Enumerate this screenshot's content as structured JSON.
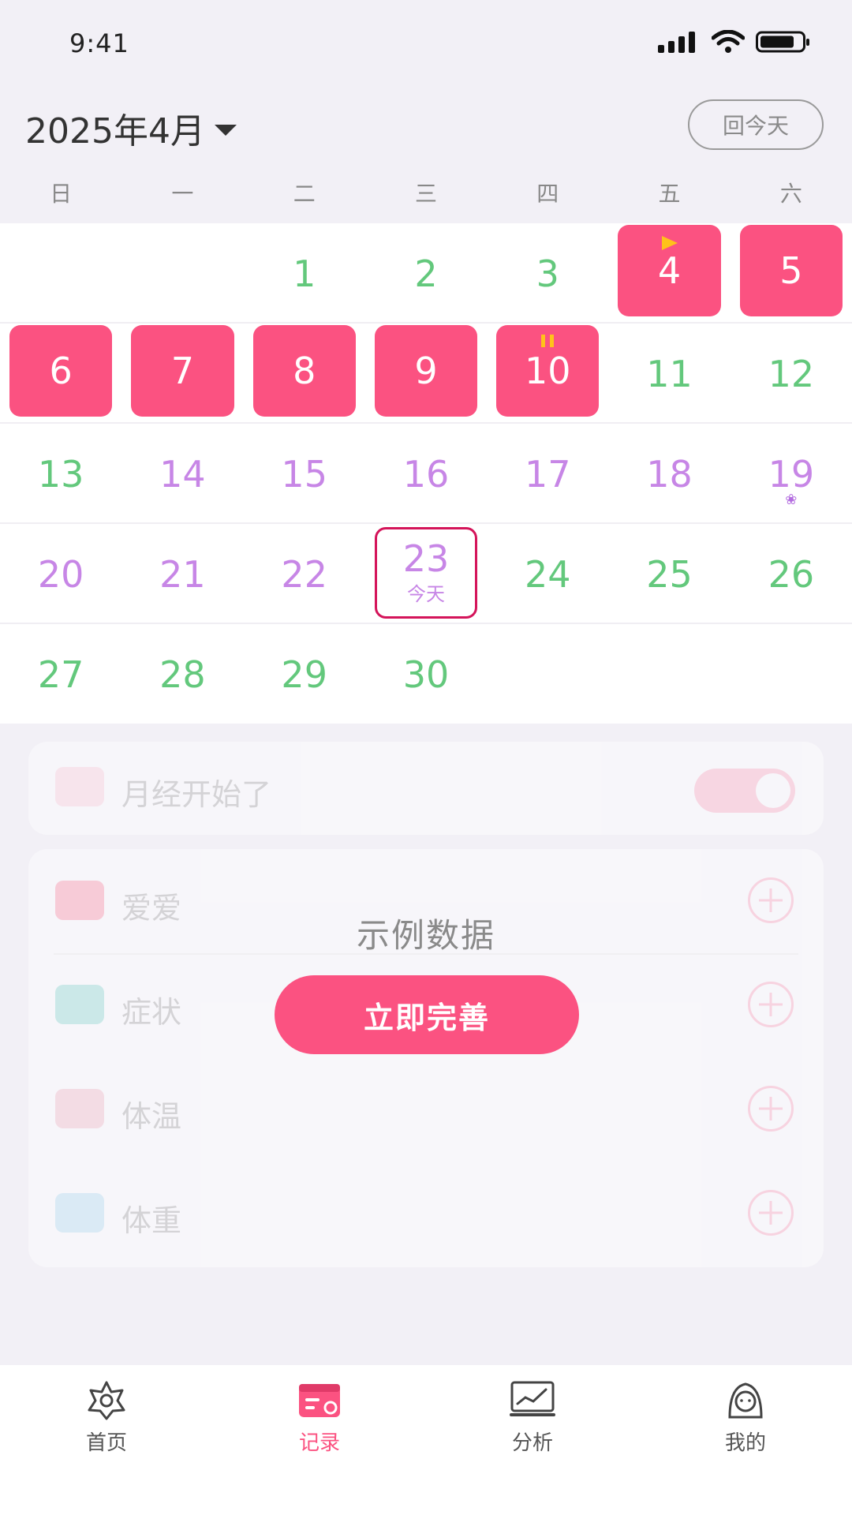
{
  "status": {
    "time": "9:41"
  },
  "header": {
    "month_title": "2025年4月",
    "today_button": "回今天"
  },
  "weekdays": [
    "日",
    "一",
    "二",
    "三",
    "四",
    "五",
    "六"
  ],
  "calendar": {
    "today_label": "今天",
    "days": [
      {
        "n": "1",
        "c": "green"
      },
      {
        "n": "2",
        "c": "green"
      },
      {
        "n": "3",
        "c": "green"
      },
      {
        "n": "4",
        "c": "period",
        "mark": "triangle"
      },
      {
        "n": "5",
        "c": "period"
      },
      {
        "n": "6",
        "c": "period"
      },
      {
        "n": "7",
        "c": "period"
      },
      {
        "n": "8",
        "c": "period"
      },
      {
        "n": "9",
        "c": "period"
      },
      {
        "n": "10",
        "c": "period",
        "mark": "pause"
      },
      {
        "n": "11",
        "c": "green"
      },
      {
        "n": "12",
        "c": "green"
      },
      {
        "n": "13",
        "c": "green"
      },
      {
        "n": "14",
        "c": "purple"
      },
      {
        "n": "15",
        "c": "purple"
      },
      {
        "n": "16",
        "c": "purple"
      },
      {
        "n": "17",
        "c": "purple"
      },
      {
        "n": "18",
        "c": "purple"
      },
      {
        "n": "19",
        "c": "purple",
        "mark": "flower"
      },
      {
        "n": "20",
        "c": "purple"
      },
      {
        "n": "21",
        "c": "purple"
      },
      {
        "n": "22",
        "c": "purple"
      },
      {
        "n": "23",
        "c": "purple",
        "today": true
      },
      {
        "n": "24",
        "c": "green"
      },
      {
        "n": "25",
        "c": "green"
      },
      {
        "n": "26",
        "c": "green"
      },
      {
        "n": "27",
        "c": "green"
      },
      {
        "n": "28",
        "c": "green"
      },
      {
        "n": "29",
        "c": "green"
      },
      {
        "n": "30",
        "c": "green"
      }
    ]
  },
  "records": {
    "period_label": "月经开始了",
    "items": [
      "爱爱",
      "症状",
      "体温",
      "体重"
    ]
  },
  "overlay": {
    "title": "示例数据",
    "button": "立即完善"
  },
  "tabbar": {
    "items": [
      {
        "label": "首页",
        "active": false
      },
      {
        "label": "记录",
        "active": true
      },
      {
        "label": "分析",
        "active": false
      },
      {
        "label": "我的",
        "active": false
      }
    ]
  },
  "colors": {
    "accent": "#fb5281",
    "green": "#63c87c",
    "purple": "#c786e6",
    "today_border": "#d4145a",
    "marker": "#ffc21a"
  }
}
